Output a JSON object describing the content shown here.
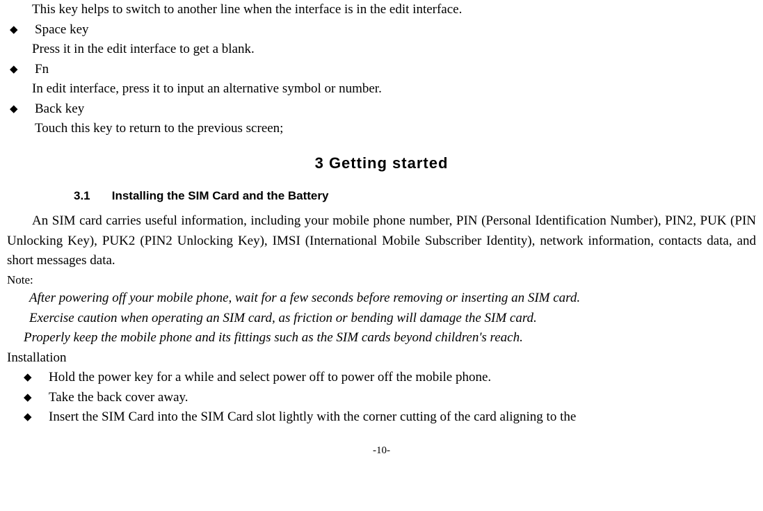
{
  "line1": "This key helps to switch to another line when the interface is in the edit interface.",
  "b1": "Space key",
  "b1desc": "Press it in the edit interface to get a blank.",
  "b2": "Fn",
  "b2desc": "In edit interface, press it to input an alternative symbol or number.",
  "b3": "Back key",
  "b3desc": "Touch this key to return to the previous screen;",
  "chapter": "3 Getting started",
  "section_num": "3.1",
  "section_title": "Installing the SIM Card and the Battery",
  "para1": "An SIM card carries useful information, including your mobile phone number, PIN (Personal Identification Number), PIN2, PUK (PIN Unlocking Key), PUK2 (PIN2 Unlocking Key), IMSI (International Mobile Subscriber Identity), network information, contacts data, and short messages data.",
  "note_label": "Note:",
  "note1": "After powering off your mobile phone, wait for a few seconds before removing or inserting an SIM card.",
  "note2": "Exercise caution when operating an SIM card, as friction or bending will damage the SIM card.",
  "note3": "Properly keep the mobile phone and its fittings such as the SIM cards beyond children's reach.",
  "install_label": "Installation",
  "i1": "Hold the power key for a while and select power off to power off the mobile phone.",
  "i2": "Take the back cover away.",
  "i3": "Insert the SIM Card into the SIM Card slot lightly with the corner cutting of the card aligning to the",
  "page": "-10-"
}
